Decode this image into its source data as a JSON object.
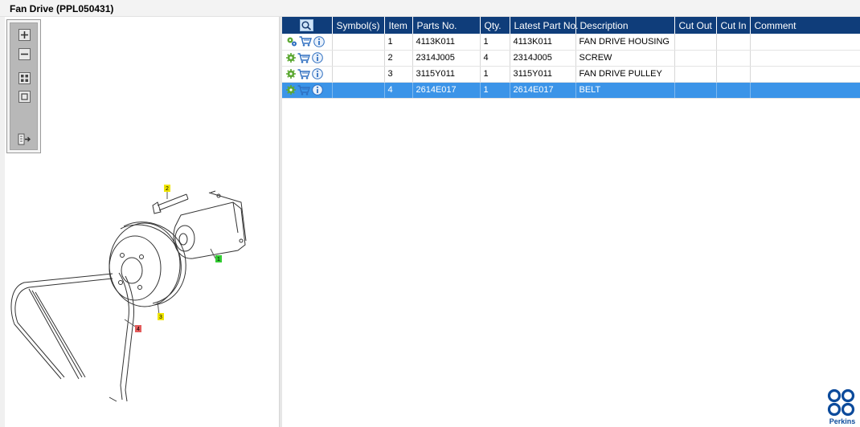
{
  "window": {
    "title": "Fan Drive (PPL050431)"
  },
  "toolbar": {
    "tools": [
      {
        "icon": "zoom-in-icon"
      },
      {
        "icon": "zoom-out-icon"
      },
      {
        "icon": "fit-grid-icon"
      },
      {
        "icon": "fit-page-icon"
      },
      {
        "icon": "export-icon"
      }
    ]
  },
  "diagram": {
    "callouts": [
      {
        "label": "1",
        "color": "#33cc33"
      },
      {
        "label": "2",
        "color": "#f0e600"
      },
      {
        "label": "3",
        "color": "#f0e600"
      },
      {
        "label": "4",
        "color": "#e35b5b"
      }
    ]
  },
  "table": {
    "header_icon": "search-parts-icon",
    "columns": [
      "Symbol(s)",
      "Item",
      "Parts No.",
      "Qty.",
      "Latest Part No.",
      "Description",
      "Cut Out",
      "Cut In",
      "Comment"
    ],
    "rows": [
      {
        "item": "1",
        "part_no": "4113K011",
        "qty": "1",
        "latest": "4113K011",
        "description": "FAN DRIVE HOUSING",
        "symbols": "",
        "cut_out": "",
        "cut_in": "",
        "comment": ""
      },
      {
        "item": "2",
        "part_no": "2314J005",
        "qty": "4",
        "latest": "2314J005",
        "description": "SCREW",
        "symbols": "",
        "cut_out": "",
        "cut_in": "",
        "comment": ""
      },
      {
        "item": "3",
        "part_no": "3115Y011",
        "qty": "1",
        "latest": "3115Y011",
        "description": "FAN DRIVE PULLEY",
        "symbols": "",
        "cut_out": "",
        "cut_in": "",
        "comment": ""
      },
      {
        "item": "4",
        "part_no": "2614E017",
        "qty": "1",
        "latest": "2614E017",
        "description": "BELT",
        "symbols": "",
        "cut_out": "",
        "cut_in": "",
        "comment": ""
      }
    ],
    "selected_row_index": 3
  },
  "brand": {
    "name": "Perkins",
    "color": "#0b4a9b"
  },
  "colors": {
    "header": "#0f3d7a",
    "selection": "#3b94e8",
    "gear": "#5ca832",
    "info": "#2f6fc0"
  }
}
